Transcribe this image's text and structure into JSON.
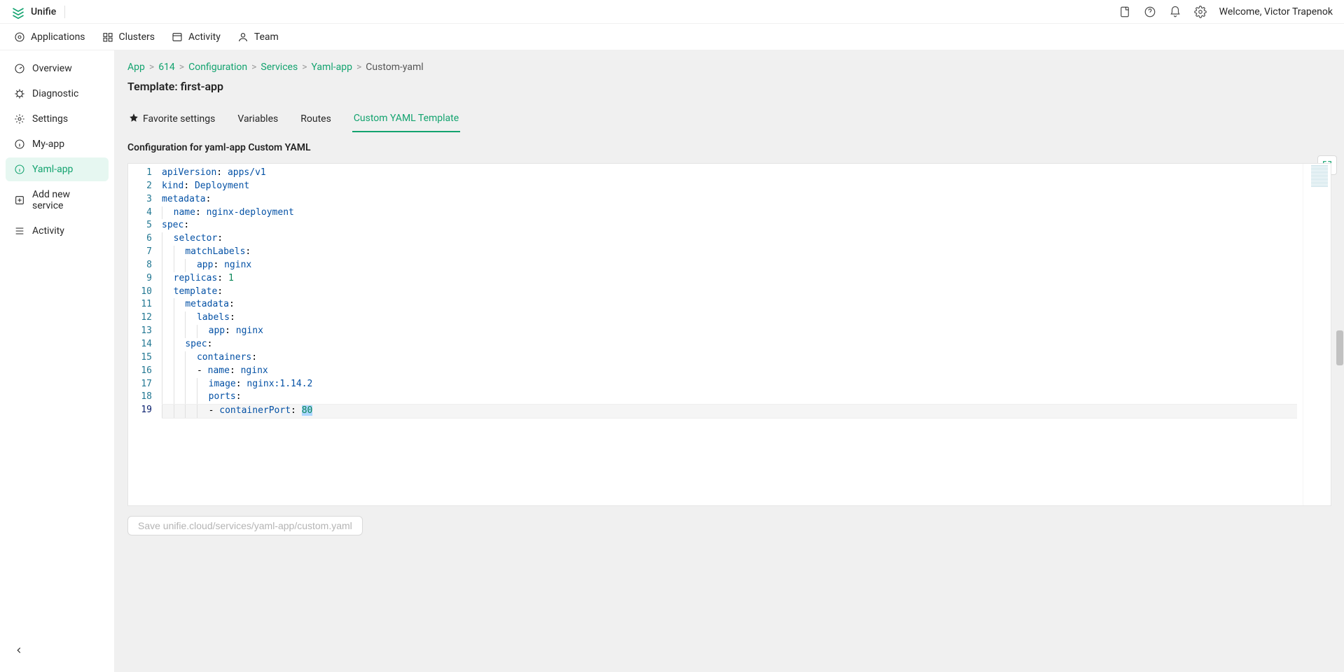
{
  "brand": "Unifie",
  "welcome_prefix": "Welcome, ",
  "user_name": "Victor Trapenok",
  "topnav": [
    {
      "label": "Applications"
    },
    {
      "label": "Clusters"
    },
    {
      "label": "Activity"
    },
    {
      "label": "Team"
    }
  ],
  "sidebar": [
    {
      "label": "Overview"
    },
    {
      "label": "Diagnostic"
    },
    {
      "label": "Settings"
    },
    {
      "label": "My-app"
    },
    {
      "label": "Yaml-app",
      "active": true
    },
    {
      "label": "Add new service"
    },
    {
      "label": "Activity"
    }
  ],
  "breadcrumb": [
    {
      "label": "App",
      "link": true
    },
    {
      "label": "614",
      "link": true
    },
    {
      "label": "Configuration",
      "link": true
    },
    {
      "label": "Services",
      "link": true
    },
    {
      "label": "Yaml-app",
      "link": true
    },
    {
      "label": "Custom-yaml",
      "link": false
    }
  ],
  "page_title": "Template: first-app",
  "tabs": [
    {
      "label": "Favorite settings",
      "star": true
    },
    {
      "label": "Variables"
    },
    {
      "label": "Routes"
    },
    {
      "label": "Custom YAML Template",
      "active": true
    }
  ],
  "section_title": "Configuration for yaml-app Custom YAML",
  "save_button": "Save unifie.cloud/services/yaml-app/custom.yaml",
  "code_lines": [
    {
      "n": 1,
      "tokens": [
        {
          "t": "apiVersion",
          "c": "key"
        },
        {
          "t": ": ",
          "c": "colon"
        },
        {
          "t": "apps/v1",
          "c": "val"
        }
      ]
    },
    {
      "n": 2,
      "tokens": [
        {
          "t": "kind",
          "c": "key"
        },
        {
          "t": ": ",
          "c": "colon"
        },
        {
          "t": "Deployment",
          "c": "val"
        }
      ]
    },
    {
      "n": 3,
      "tokens": [
        {
          "t": "metadata",
          "c": "key"
        },
        {
          "t": ":",
          "c": "colon"
        }
      ]
    },
    {
      "n": 4,
      "indent": 1,
      "tokens": [
        {
          "t": "name",
          "c": "key"
        },
        {
          "t": ": ",
          "c": "colon"
        },
        {
          "t": "nginx-deployment",
          "c": "val"
        }
      ]
    },
    {
      "n": 5,
      "tokens": [
        {
          "t": "spec",
          "c": "key"
        },
        {
          "t": ":",
          "c": "colon"
        }
      ]
    },
    {
      "n": 6,
      "indent": 1,
      "tokens": [
        {
          "t": "selector",
          "c": "key"
        },
        {
          "t": ":",
          "c": "colon"
        }
      ]
    },
    {
      "n": 7,
      "indent": 2,
      "tokens": [
        {
          "t": "matchLabels",
          "c": "key"
        },
        {
          "t": ":",
          "c": "colon"
        }
      ]
    },
    {
      "n": 8,
      "indent": 3,
      "tokens": [
        {
          "t": "app",
          "c": "key"
        },
        {
          "t": ": ",
          "c": "colon"
        },
        {
          "t": "nginx",
          "c": "val"
        }
      ]
    },
    {
      "n": 9,
      "indent": 1,
      "tokens": [
        {
          "t": "replicas",
          "c": "key"
        },
        {
          "t": ": ",
          "c": "colon"
        },
        {
          "t": "1",
          "c": "num"
        }
      ]
    },
    {
      "n": 10,
      "indent": 1,
      "tokens": [
        {
          "t": "template",
          "c": "key"
        },
        {
          "t": ":",
          "c": "colon"
        }
      ]
    },
    {
      "n": 11,
      "indent": 2,
      "tokens": [
        {
          "t": "metadata",
          "c": "key"
        },
        {
          "t": ":",
          "c": "colon"
        }
      ]
    },
    {
      "n": 12,
      "indent": 3,
      "tokens": [
        {
          "t": "labels",
          "c": "key"
        },
        {
          "t": ":",
          "c": "colon"
        }
      ]
    },
    {
      "n": 13,
      "indent": 4,
      "tokens": [
        {
          "t": "app",
          "c": "key"
        },
        {
          "t": ": ",
          "c": "colon"
        },
        {
          "t": "nginx",
          "c": "val"
        }
      ]
    },
    {
      "n": 14,
      "indent": 2,
      "tokens": [
        {
          "t": "spec",
          "c": "key"
        },
        {
          "t": ":",
          "c": "colon"
        }
      ]
    },
    {
      "n": 15,
      "indent": 3,
      "tokens": [
        {
          "t": "containers",
          "c": "key"
        },
        {
          "t": ":",
          "c": "colon"
        }
      ]
    },
    {
      "n": 16,
      "indent": 3,
      "tokens": [
        {
          "t": "- ",
          "c": "dash"
        },
        {
          "t": "name",
          "c": "key"
        },
        {
          "t": ": ",
          "c": "colon"
        },
        {
          "t": "nginx",
          "c": "val"
        }
      ]
    },
    {
      "n": 17,
      "indent": 4,
      "tokens": [
        {
          "t": "image",
          "c": "key"
        },
        {
          "t": ": ",
          "c": "colon"
        },
        {
          "t": "nginx:1.14.2",
          "c": "val"
        }
      ]
    },
    {
      "n": 18,
      "indent": 4,
      "tokens": [
        {
          "t": "ports",
          "c": "key"
        },
        {
          "t": ":",
          "c": "colon"
        }
      ]
    },
    {
      "n": 19,
      "cur": true,
      "indent": 4,
      "tokens": [
        {
          "t": "- ",
          "c": "dash"
        },
        {
          "t": "containerPort",
          "c": "key"
        },
        {
          "t": ": ",
          "c": "colon"
        },
        {
          "t": "80",
          "c": "num",
          "sel": true
        }
      ]
    }
  ]
}
